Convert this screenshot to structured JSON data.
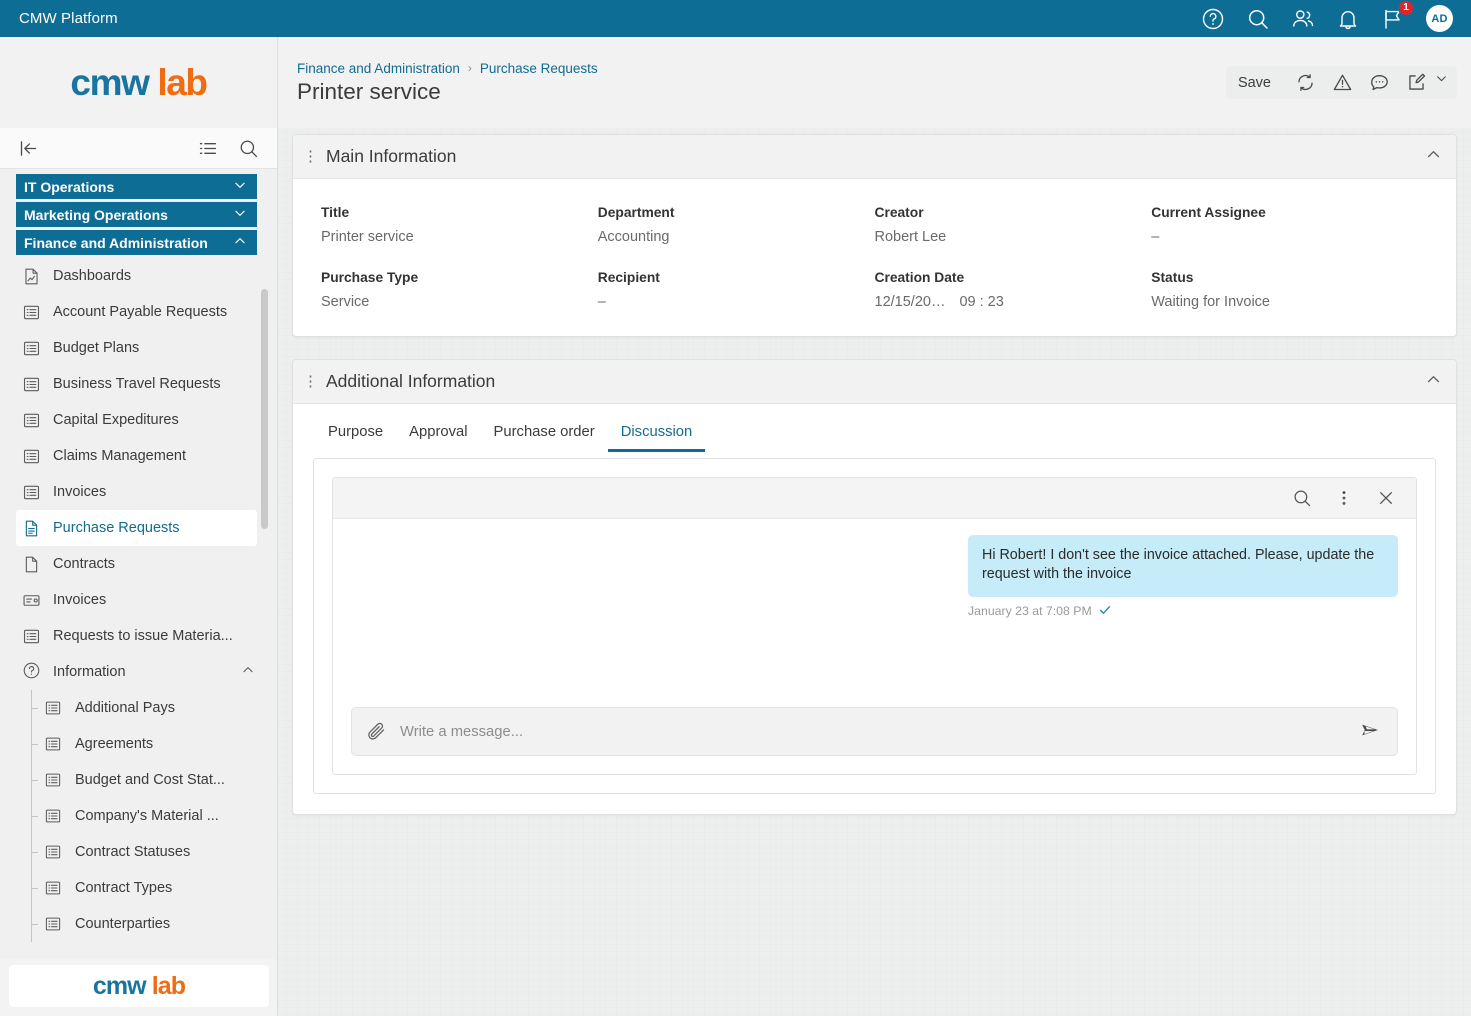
{
  "topbar": {
    "title": "CMW Platform",
    "icons": [
      {
        "name": "help-icon"
      },
      {
        "name": "search-icon"
      },
      {
        "name": "users-icon"
      },
      {
        "name": "bell-icon"
      },
      {
        "name": "flag-icon",
        "badge": "1"
      }
    ],
    "avatar_initials": "AD",
    "accent_color": "#0e6d94",
    "badge_color": "#e0242b"
  },
  "brand": {
    "part1": "cmw",
    "part2": "lab",
    "color1": "#1a74a0",
    "color2": "#ef6c13"
  },
  "header": {
    "breadcrumb": [
      "Finance and Administration",
      "Purchase Requests"
    ],
    "breadcrumb_separator": "›",
    "page_title": "Printer service",
    "toolbar": {
      "save_label": "Save",
      "icons": [
        "sync-icon",
        "warning-icon",
        "comment-icon",
        "edit-icon",
        "chevron-down-icon"
      ]
    }
  },
  "sidebar": {
    "toolbar_icons": [
      "collapse-panel-icon",
      "list-view-icon",
      "search-icon"
    ],
    "groups": [
      {
        "label": "IT Operations",
        "expanded": false
      },
      {
        "label": "Marketing Operations",
        "expanded": false
      },
      {
        "label": "Finance and Administration",
        "expanded": true
      }
    ],
    "items": [
      {
        "label": "Dashboards",
        "icon": "dashboard-icon",
        "active": false
      },
      {
        "label": "Account Payable Requests",
        "icon": "list-icon",
        "active": false
      },
      {
        "label": "Budget Plans",
        "icon": "list-icon",
        "active": false
      },
      {
        "label": "Business Travel Requests",
        "icon": "list-icon",
        "active": false
      },
      {
        "label": "Capital Expeditures",
        "icon": "list-icon",
        "active": false
      },
      {
        "label": "Claims Management",
        "icon": "list-icon",
        "active": false
      },
      {
        "label": "Invoices",
        "icon": "list-icon",
        "active": false
      },
      {
        "label": "Purchase Requests",
        "icon": "document-icon",
        "active": true
      },
      {
        "label": "Contracts",
        "icon": "file-icon",
        "active": false
      },
      {
        "label": "Invoices",
        "icon": "card-icon",
        "active": false
      },
      {
        "label": "Requests to issue Materia...",
        "icon": "list-icon",
        "active": false
      }
    ],
    "section": {
      "label": "Information",
      "icon": "question-circle-icon",
      "expanded": true
    },
    "nested_items": [
      {
        "label": "Additional Pays",
        "icon": "list-icon"
      },
      {
        "label": "Agreements",
        "icon": "list-icon"
      },
      {
        "label": "Budget and Cost Stat...",
        "icon": "list-icon"
      },
      {
        "label": "Company's Material ...",
        "icon": "list-icon"
      },
      {
        "label": "Contract Statuses",
        "icon": "list-icon"
      },
      {
        "label": "Contract Types",
        "icon": "list-icon"
      },
      {
        "label": "Counterparties",
        "icon": "list-icon"
      }
    ]
  },
  "main_information": {
    "title": "Main Information",
    "fields": [
      {
        "label": "Title",
        "value": "Printer service"
      },
      {
        "label": "Department",
        "value": "Accounting"
      },
      {
        "label": "Creator",
        "value": "Robert Lee"
      },
      {
        "label": "Current Assignee",
        "value": "–"
      },
      {
        "label": "Purchase Type",
        "value": "Service"
      },
      {
        "label": "Recipient",
        "value": "–"
      },
      {
        "label": "Creation Date",
        "value": "12/15/20…",
        "value2": "09 : 23"
      },
      {
        "label": "Status",
        "value": "Waiting for Invoice"
      }
    ]
  },
  "additional_information": {
    "title": "Additional Information",
    "tabs": [
      {
        "label": "Purpose",
        "active": false
      },
      {
        "label": "Approval",
        "active": false
      },
      {
        "label": "Purchase order",
        "active": false
      },
      {
        "label": "Discussion",
        "active": true
      }
    ],
    "chat": {
      "toolbar_icons": [
        "search-icon",
        "more-vertical-icon",
        "close-icon"
      ],
      "messages": [
        {
          "text": "Hi Robert! I don't see the invoice attached. Please, update the request with the invoice",
          "timestamp": "January 23 at 7:08 PM",
          "status": "read",
          "outgoing": true
        }
      ],
      "input_placeholder": "Write a message...",
      "input_value": "",
      "attach_icon": "paperclip-icon",
      "send_icon": "send-icon"
    }
  }
}
